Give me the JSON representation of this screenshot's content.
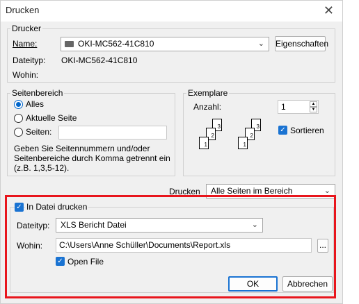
{
  "window": {
    "title": "Drucken",
    "close_glyph": "✕"
  },
  "printer": {
    "group_label": "Drucker",
    "name_label": "Name:",
    "name_value": "OKI-MC562-41C810",
    "properties_button": "Eigenschaften",
    "type_label": "Dateityp:",
    "type_value": "OKI-MC562-41C810",
    "where_label": "Wohin:"
  },
  "range": {
    "group_label": "Seitenbereich",
    "all_label": "Alles",
    "current_label": "Aktuelle Seite",
    "pages_label": "Seiten:",
    "pages_value": "",
    "help_text_1": "Geben Sie Seitennummern und/oder",
    "help_text_2": "Seitenbereiche durch Komma getrennt ein",
    "help_text_3": "(z.B. 1,3,5-12).",
    "selected": "all"
  },
  "copies": {
    "group_label": "Exemplare",
    "count_label": "Anzahl:",
    "count_value": "1",
    "collate_label": "Sortieren",
    "collate_checked": true,
    "page_numbers": [
      "1",
      "2",
      "3"
    ]
  },
  "print_what": {
    "label": "Drucken",
    "value": "Alle Seiten im Bereich"
  },
  "file_output": {
    "checkbox_label": "In Datei drucken",
    "checked": true,
    "type_label": "Dateityp:",
    "type_value": "XLS Bericht Datei",
    "where_label": "Wohin:",
    "path_value": "C:\\Users\\Anne Schüller\\Documents\\Report.xls",
    "browse_label": "...",
    "open_file_label": "Open File",
    "open_file_checked": true
  },
  "buttons": {
    "ok": "OK",
    "cancel": "Abbrechen"
  },
  "colors": {
    "highlight": "#e8151c",
    "accent": "#1a73d2"
  }
}
